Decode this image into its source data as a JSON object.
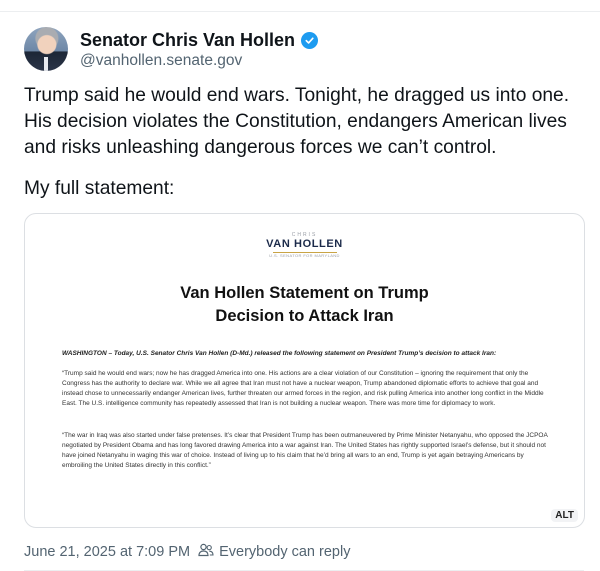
{
  "author": {
    "display_name": "Senator Chris Van Hollen",
    "handle": "@vanhollen.senate.gov"
  },
  "post": {
    "text": "Trump said he would end wars. Tonight, he dragged us into one.\nHis decision violates the Constitution, endangers American lives\nand risks unleashing dangerous forces we can’t control.",
    "statement_label": "My full statement:"
  },
  "image": {
    "logo_top": "CHRIS",
    "logo_main": "VAN HOLLEN",
    "logo_sub": "U.S. SENATOR FOR MARYLAND",
    "title": "Van Hollen Statement on Trump\nDecision to Attack Iran",
    "dateline": "WASHINGTON – Today, U.S. Senator Chris Van Hollen (D-Md.) released the following statement on President Trump’s decision to attack Iran:",
    "paragraph_1": "“Trump said he would end wars; now he has dragged America into one. His actions are a clear violation of our Constitution – ignoring the requirement that only the Congress has the authority to declare war. While we all agree that Iran must not have a nuclear weapon, Trump abandoned diplomatic efforts to achieve that goal and instead chose to unnecessarily endanger American lives, further threaten our armed forces in the region, and risk pulling America into another long conflict in the Middle East. The U.S. intelligence community has repeatedly assessed that Iran is not building a nuclear weapon. There was more time for diplomacy to work.",
    "paragraph_2": "“The war in Iraq was also started under false pretenses. It’s clear that President Trump has been outmaneuvered by Prime Minister Netanyahu, who opposed the JCPOA negotiated by President Obama and has long favored drawing America into a war against Iran. The United States has rightly supported Israel’s defense, but it should not have joined Netanyahu in waging this war of choice. Instead of living up to his claim that he’d bring all wars to an end, Trump is yet again betraying Americans by embroiling the United States directly in this conflict.”",
    "alt_badge": "ALT"
  },
  "meta": {
    "timestamp": "June 21, 2025 at 7:09 PM",
    "reply_setting": "Everybody can reply"
  },
  "icons": {
    "verified": "verified-badge-icon",
    "reply_audience": "people-icon"
  },
  "colors": {
    "verified": "#1d9bf0",
    "secondary_text": "#536471"
  }
}
